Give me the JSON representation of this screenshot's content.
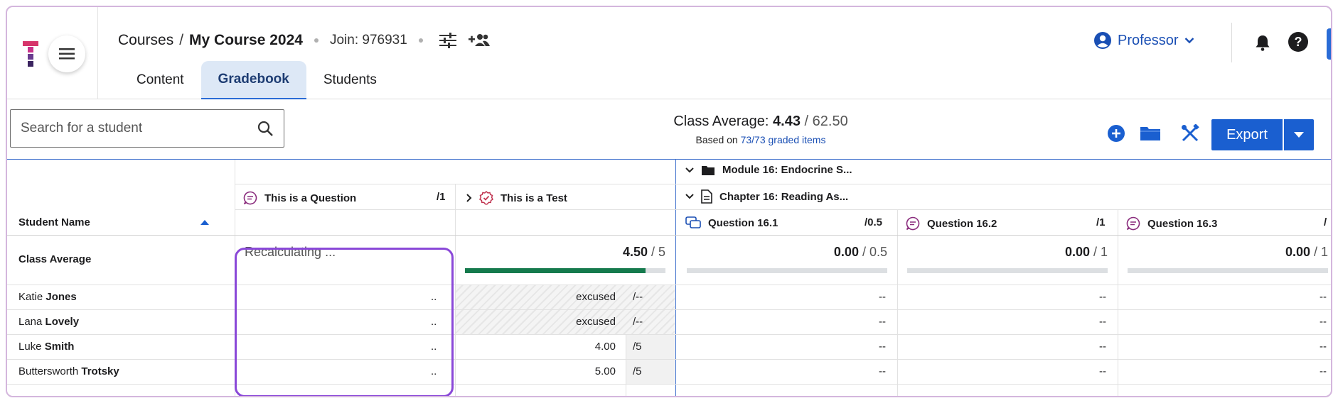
{
  "header": {
    "breadcrumb": {
      "root": "Courses",
      "separator": "/",
      "current": "My Course 2024"
    },
    "join": "Join: 976931",
    "tabs": [
      {
        "label": "Content",
        "active": false
      },
      {
        "label": "Gradebook",
        "active": true
      },
      {
        "label": "Students",
        "active": false
      }
    ],
    "user_role": "Professor"
  },
  "toolbar": {
    "search_placeholder": "Search for a student",
    "class_average_label": "Class Average: ",
    "class_average_value": "4.43",
    "class_average_total": " / 62.50",
    "based_on_prefix": "Based on ",
    "based_on_link": "73/73 graded items",
    "export_label": "Export"
  },
  "gradebook": {
    "module": "Module 16: Endocrine S...",
    "chapter": "Chapter 16: Reading As...",
    "student_name_header": "Student Name",
    "columns": [
      {
        "title": "This is a Question",
        "max": "/1"
      },
      {
        "title": "This is a Test",
        "max": ""
      },
      {
        "title": "Question 16.1",
        "max": "/0.5"
      },
      {
        "title": "Question 16.2",
        "max": "/1"
      },
      {
        "title": "Question 16.3",
        "max": "/"
      }
    ],
    "class_average": {
      "label": "Class Average",
      "question_status": "Recalculating ...",
      "test": {
        "value": "4.50",
        "total": " / 5",
        "fill": 0.9
      },
      "q161": {
        "value": "0.00",
        "total": " / 0.5",
        "fill": 0
      },
      "q162": {
        "value": "0.00",
        "total": " / 1",
        "fill": 0
      },
      "q163": {
        "value": "0.00",
        "total": " / 1",
        "fill": 0
      }
    },
    "students": [
      {
        "first": "Katie",
        "last": "Jones",
        "question": "..",
        "test_value": "excused",
        "test_max": "/--",
        "q161": "--",
        "q162": "--",
        "q163": "--"
      },
      {
        "first": "Lana",
        "last": "Lovely",
        "question": "..",
        "test_value": "excused",
        "test_max": "/--",
        "q161": "--",
        "q162": "--",
        "q163": "--"
      },
      {
        "first": "Luke",
        "last": "Smith",
        "question": "..",
        "test_value": "4.00",
        "test_max": "/5",
        "q161": "--",
        "q162": "--",
        "q163": "--"
      },
      {
        "first": "Buttersworth",
        "last": "Trotsky",
        "question": "..",
        "test_value": "5.00",
        "test_max": "/5",
        "q161": "--",
        "q162": "--",
        "q163": "--"
      }
    ]
  },
  "colors": {
    "accent": "#1a5fd0",
    "highlight": "#8a48d8",
    "progress": "#157a4d"
  },
  "icons": [
    "logo-icon",
    "hamburger-icon",
    "sliders-icon",
    "add-person-icon",
    "user-circle-icon",
    "chevron-down-icon",
    "bell-icon",
    "help-icon",
    "search-icon",
    "add-circle-icon",
    "folder-icon",
    "tools-icon",
    "sort-up-icon",
    "question-icon",
    "test-icon",
    "chevron-right-icon",
    "folder-dark-icon",
    "document-icon"
  ]
}
